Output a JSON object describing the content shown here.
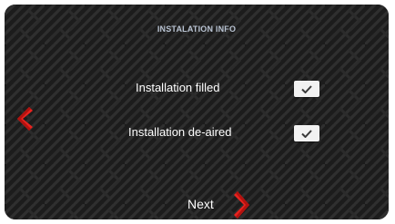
{
  "header": {
    "title": "INSTALATION INFO"
  },
  "checklist": [
    {
      "label": "Installation filled",
      "checked": true
    },
    {
      "label": "Installation de-aired",
      "checked": true
    }
  ],
  "nav": {
    "back_icon": "chevron-left-icon",
    "next_label": "Next",
    "next_icon": "chevron-right-icon"
  },
  "colors": {
    "background": "#1c1c1c",
    "pattern_line": "#303030",
    "accent_red": "#e8231f",
    "title": "#b9c3d2",
    "checkbox_fill": "#f2f2f2",
    "checkmark": "#3a3a3a"
  }
}
